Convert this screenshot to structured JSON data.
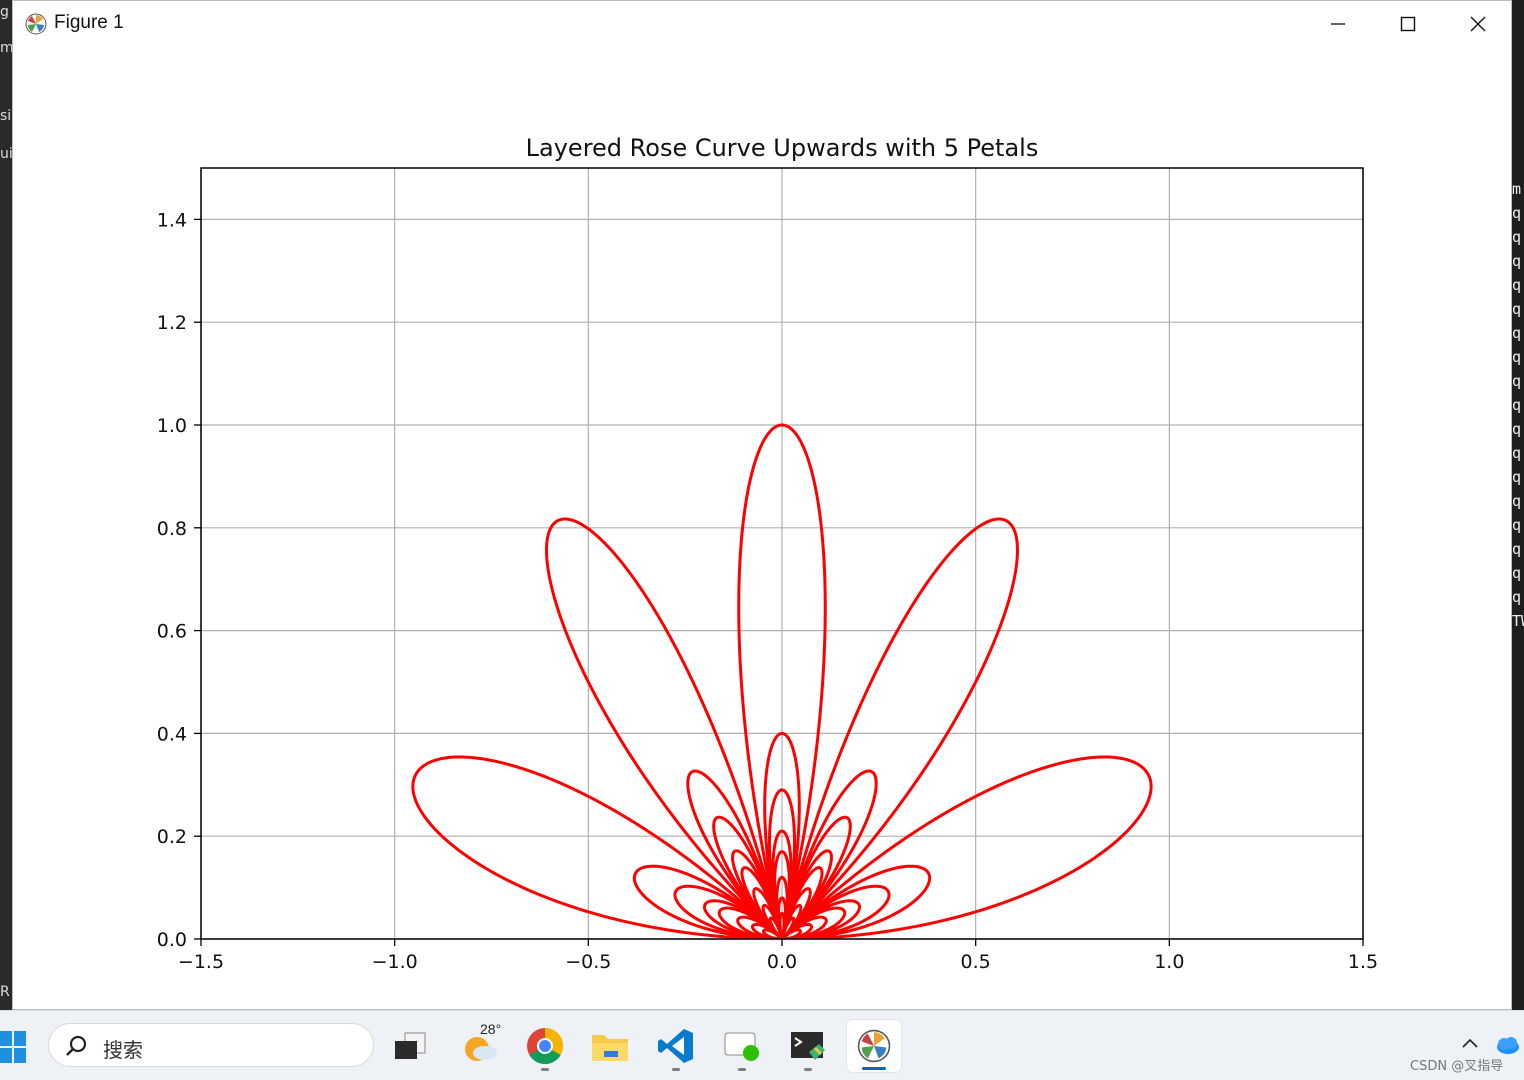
{
  "window": {
    "title": "Figure 1"
  },
  "chart_data": {
    "type": "line",
    "title": "Layered Rose Curve Upwards with 5 Petals",
    "xlabel": "",
    "ylabel": "",
    "xlim": [
      -1.5,
      1.5
    ],
    "ylim": [
      0.0,
      1.5
    ],
    "xticks": [
      -1.5,
      -1.0,
      -0.5,
      0.0,
      0.5,
      1.0,
      1.5
    ],
    "xtick_labels": [
      "−1.5",
      "−1.0",
      "−0.5",
      "0.0",
      "0.5",
      "1.0",
      "1.5"
    ],
    "yticks": [
      0.0,
      0.2,
      0.4,
      0.6,
      0.8,
      1.0,
      1.2,
      1.4
    ],
    "ytick_labels": [
      "0.0",
      "0.2",
      "0.4",
      "0.6",
      "0.8",
      "1.0",
      "1.2",
      "1.4"
    ],
    "grid": true,
    "line_color": "#ff0000",
    "series": [
      {
        "curve": "layered rose",
        "petals": 5,
        "petal_peaks_xy": [
          [
            -0.92,
            0.39
          ],
          [
            -0.39,
            0.92
          ],
          [
            0.39,
            0.92
          ],
          [
            0.92,
            0.39
          ]
        ],
        "inner_layer_peaks_y": [
          0.37,
          0.27,
          0.2,
          0.16
        ]
      }
    ]
  },
  "taskbar": {
    "search_placeholder": "搜索",
    "weather_temp": "28°",
    "apps": [
      "task-view",
      "weather",
      "chrome",
      "file-explorer",
      "vscode",
      "wechat",
      "terminal",
      "matplotlib-figure"
    ],
    "watermark": "CSDN @叉指导"
  },
  "background": {
    "left_fragments": [
      "g",
      "m",
      "si",
      "ui",
      "R"
    ],
    "right_fragments": [
      "m",
      "q",
      "q",
      "q",
      "q",
      "q",
      "q",
      "q",
      "q",
      "q",
      "q",
      "q",
      "q",
      "q",
      "q",
      "q",
      "q",
      "q",
      "TW"
    ]
  }
}
